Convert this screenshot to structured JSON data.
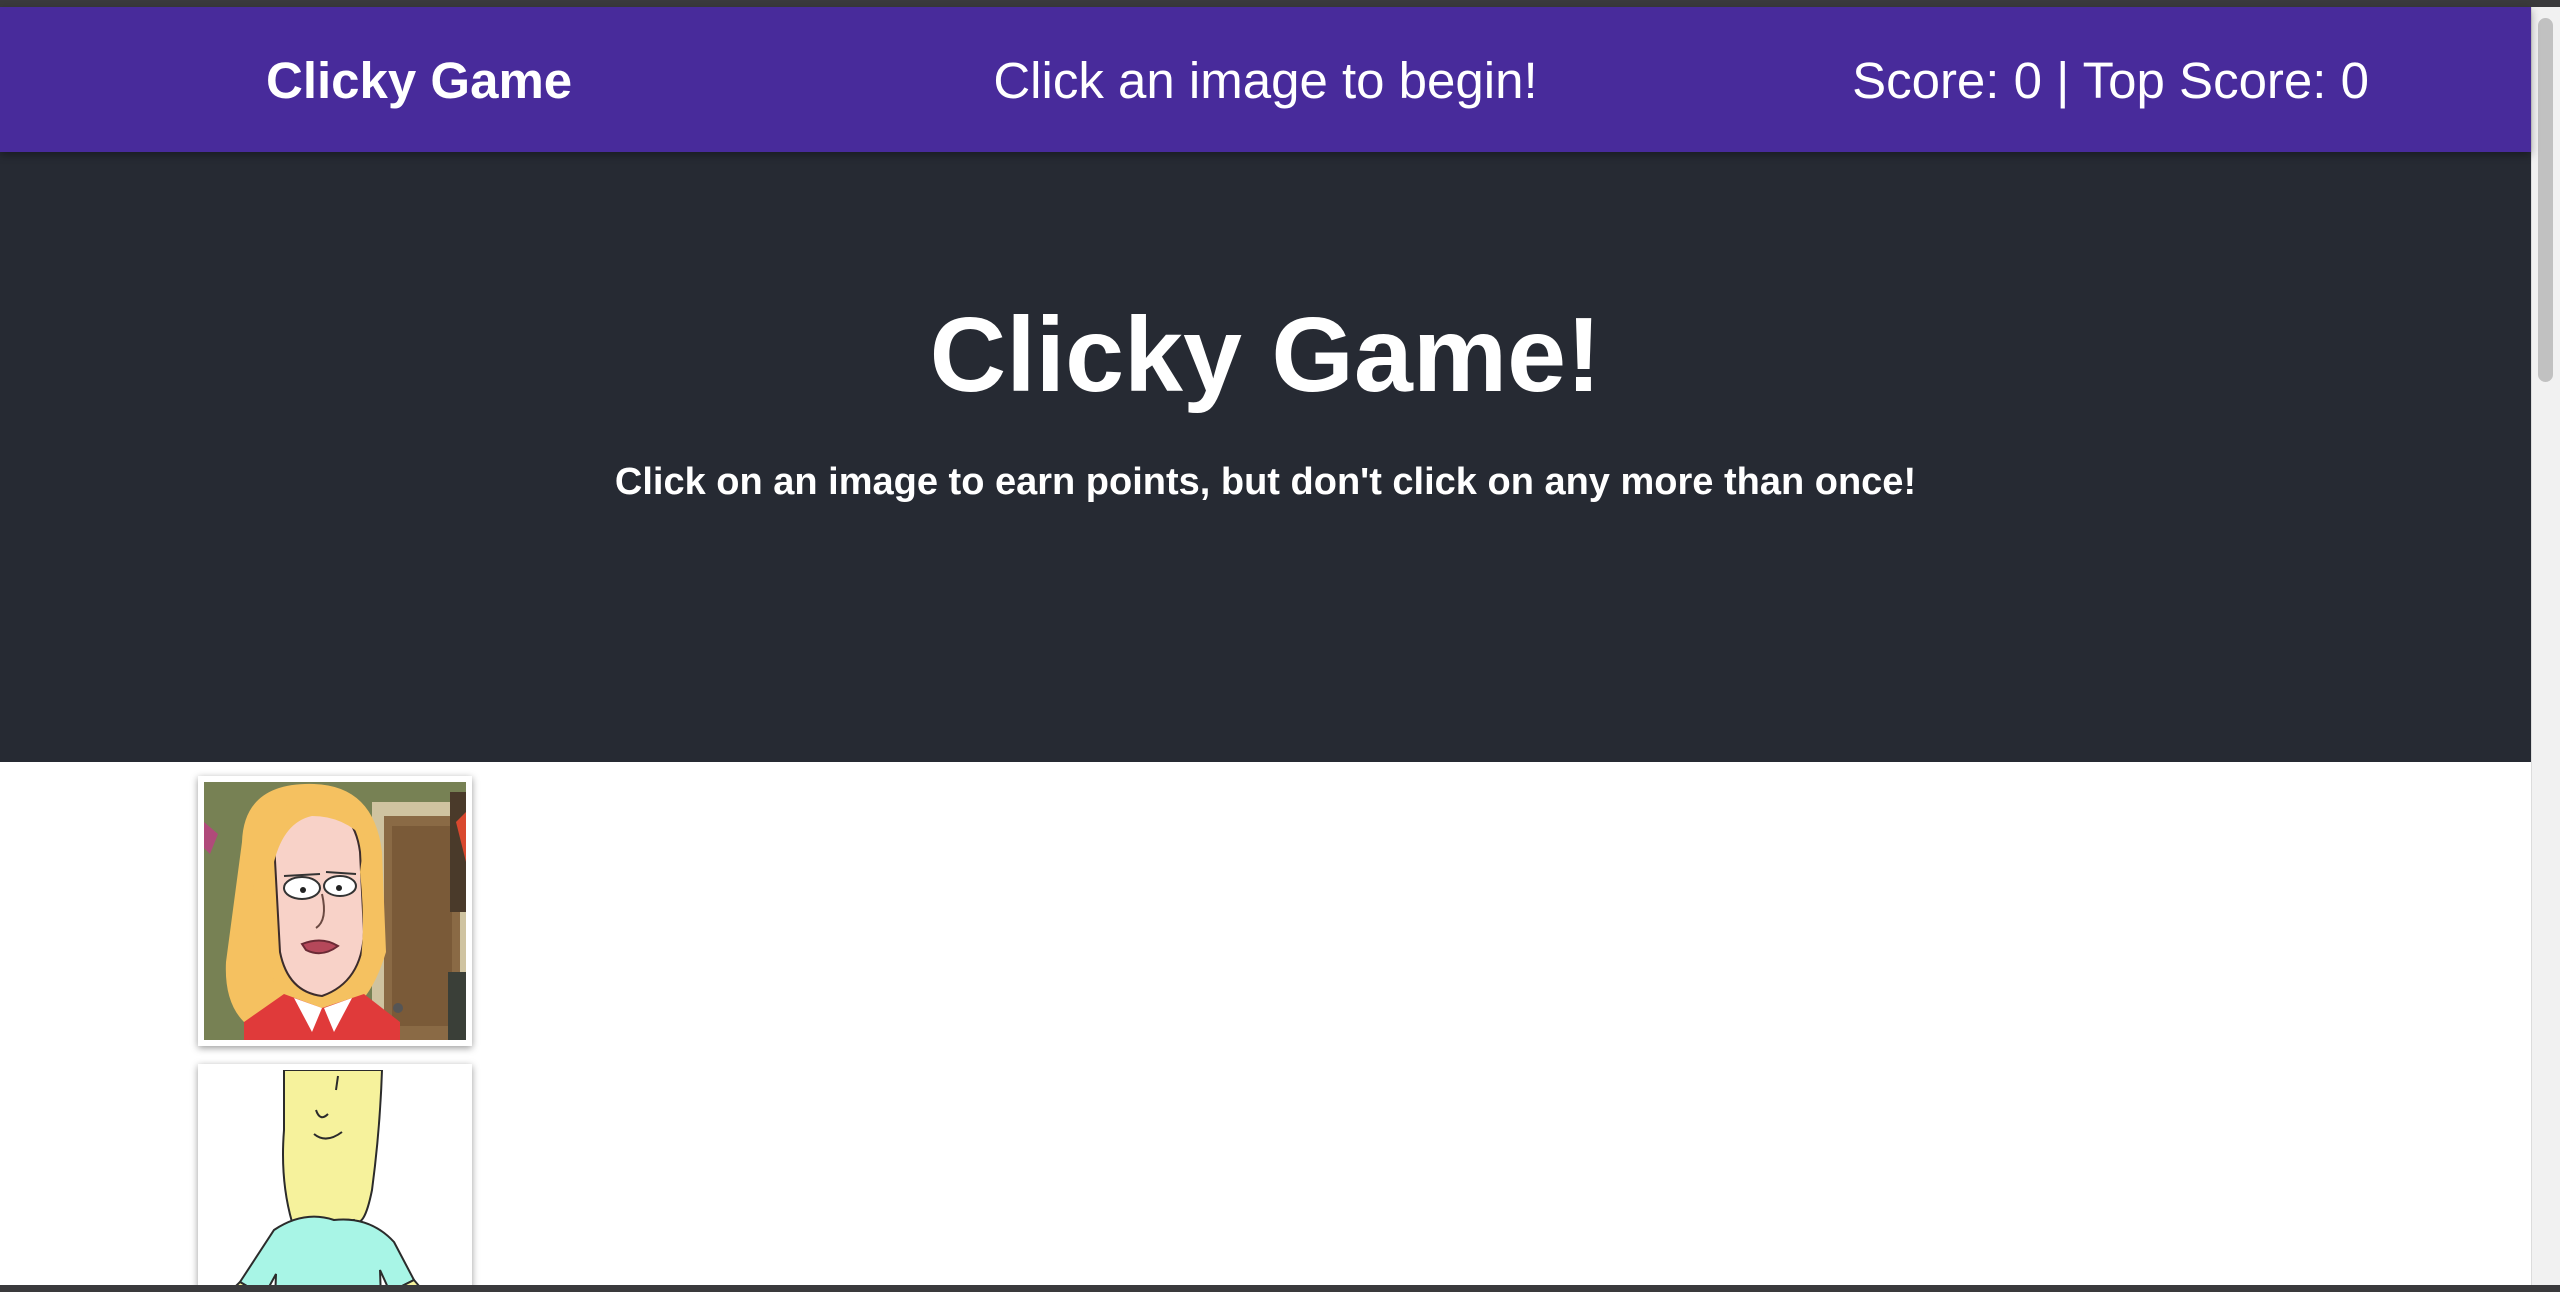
{
  "navbar": {
    "brand": "Clicky Game",
    "message": "Click an image to begin!",
    "score_text": "Score: 0 | Top Score: 0"
  },
  "hero": {
    "title": "Clicky Game!",
    "subtitle": "Click on an image to earn points, but don't click on any more than once!"
  },
  "game": {
    "score": 0,
    "top_score": 0
  },
  "colors": {
    "navbar": "#482b9b",
    "jumbotron": "#262a33",
    "text": "#ffffff"
  }
}
